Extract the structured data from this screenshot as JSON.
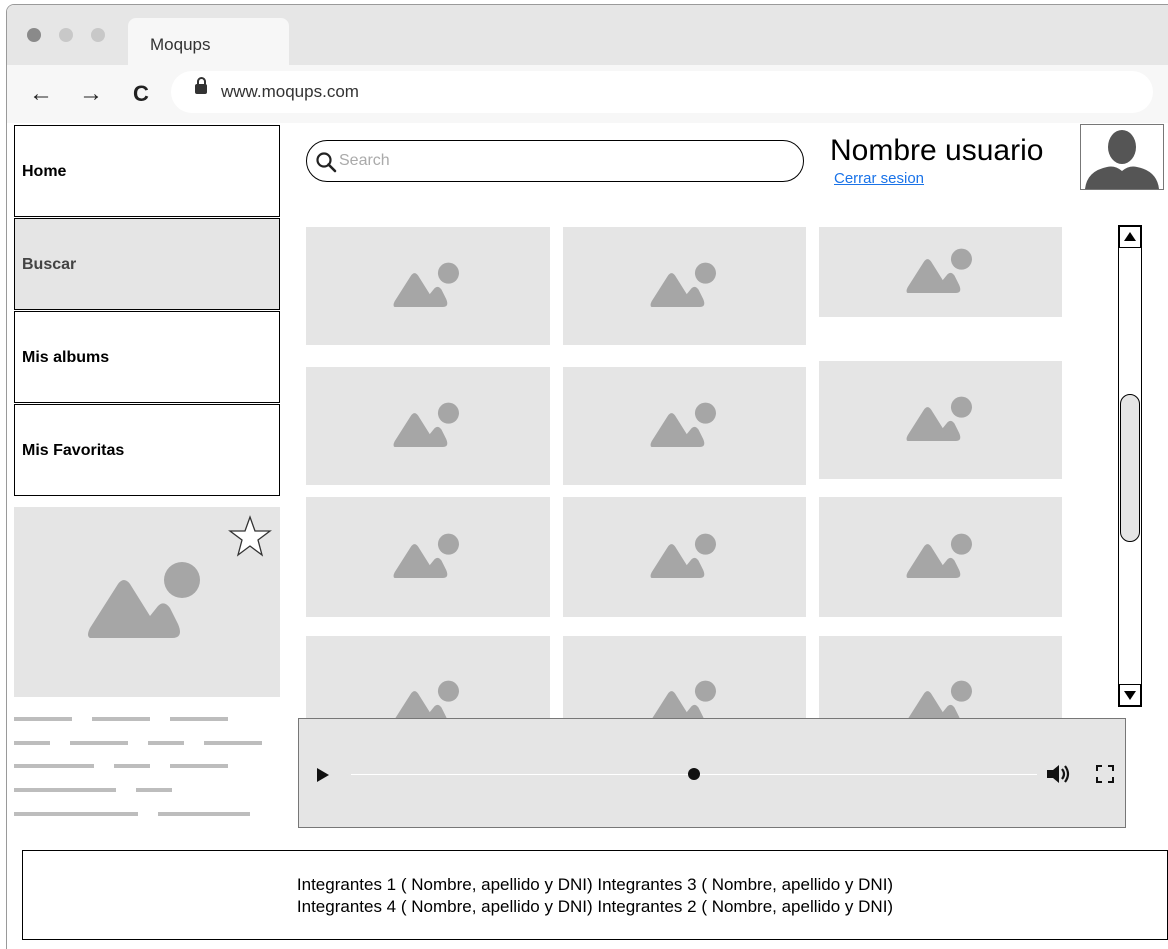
{
  "browser": {
    "tab_title": "Moqups",
    "url": "www.moqups.com",
    "back_icon": "←",
    "forward_icon": "→",
    "reload_icon": "C"
  },
  "sidebar": {
    "items": [
      {
        "label": "Home",
        "active": false
      },
      {
        "label": "Buscar",
        "active": true
      },
      {
        "label": "Mis albums",
        "active": false
      },
      {
        "label": "Mis Favoritas",
        "active": false
      }
    ]
  },
  "header": {
    "search_placeholder": "Search",
    "username": "Nombre usuario",
    "logout_label": "Cerrar sesion"
  },
  "player": {
    "progress": 0.5
  },
  "footer": {
    "line1": "Integrantes 1 ( Nombre, apellido y DNI) Integrantes 3 ( Nombre, apellido y DNI)",
    "line2": "Integrantes 4 ( Nombre, apellido y DNI) Integrantes 2 ( Nombre, apellido y DNI)"
  },
  "colors": {
    "placeholder_bg": "#e5e5e5",
    "placeholder_icon": "#a6a6a6",
    "link": "#1a73e8"
  }
}
